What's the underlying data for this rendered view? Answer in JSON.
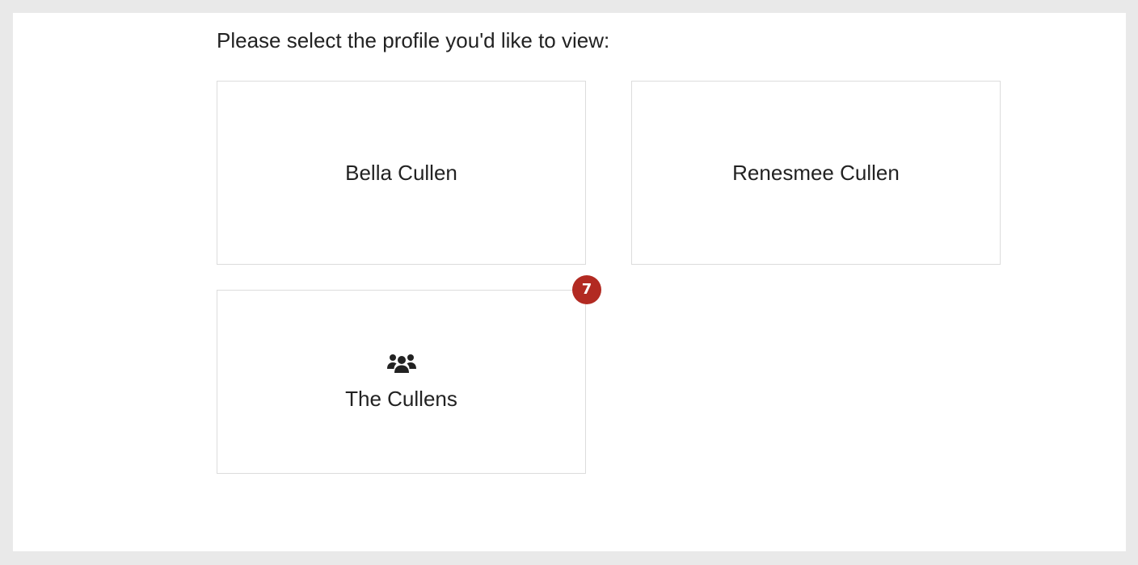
{
  "prompt": "Please select the profile you'd like to view:",
  "profiles": [
    {
      "name": "Bella Cullen",
      "icon": null,
      "badge": null
    },
    {
      "name": "Renesmee Cullen",
      "icon": null,
      "badge": null
    },
    {
      "name": "The Cullens",
      "icon": "users-group-icon",
      "badge": "7"
    }
  ],
  "colors": {
    "page_background": "#e9e9e9",
    "panel_background": "#ffffff",
    "card_border": "#dcdcdc",
    "text": "#222222",
    "badge_background": "#b22a22",
    "badge_text": "#ffffff"
  }
}
